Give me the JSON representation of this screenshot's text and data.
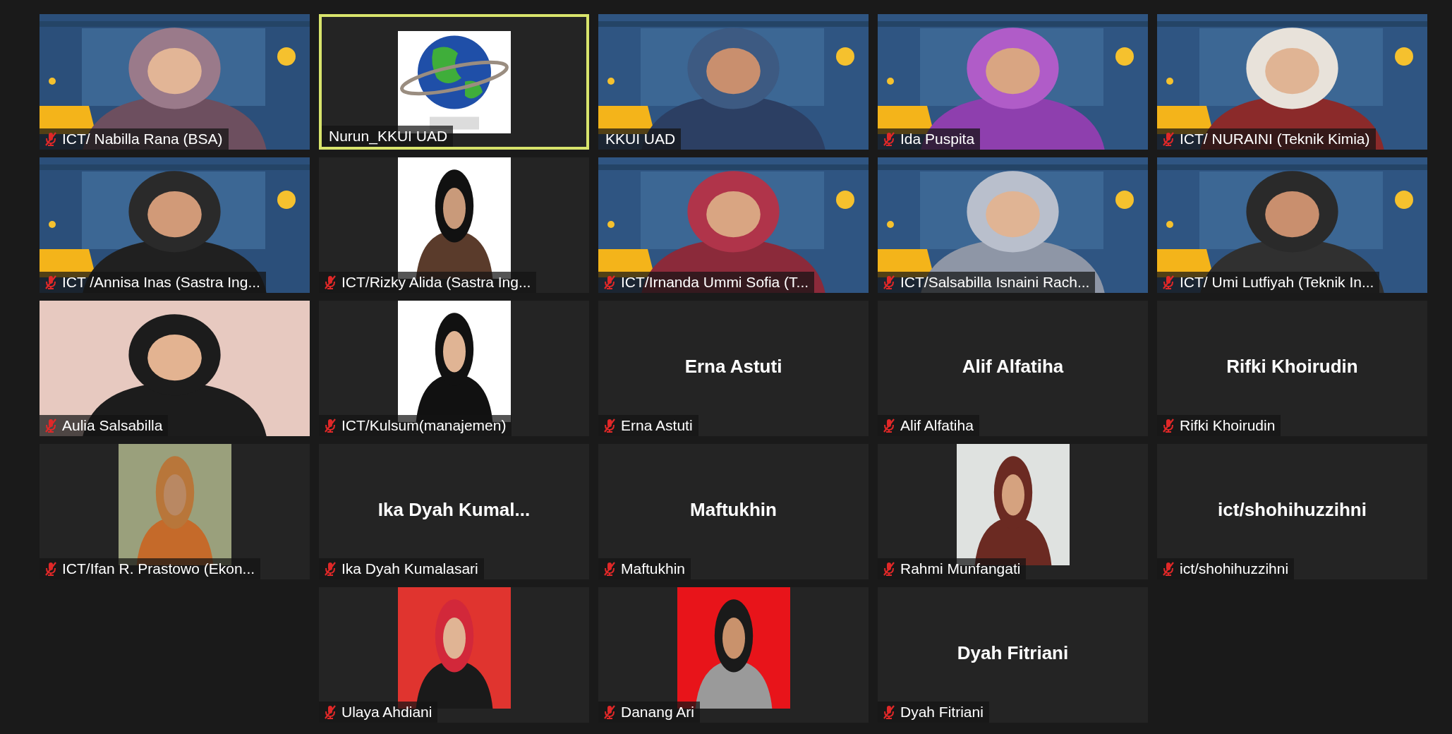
{
  "rows": [
    {
      "tiles": [
        {
          "kind": "video",
          "name": "ICT/ Nabilla Rana (BSA)",
          "muted": true,
          "speaking": false
        },
        {
          "name": "Nurun_KKUI UAD",
          "muted": false,
          "speaking": true
        },
        {
          "kind": "video",
          "name": "KKUI UAD",
          "muted": false,
          "speaking": false
        },
        {
          "kind": "video",
          "name": "Ida Puspita",
          "muted": true,
          "speaking": false
        },
        {
          "kind": "video",
          "name": "ICT/ NURAINI (Teknik Kimia)",
          "muted": true,
          "speaking": false
        }
      ]
    },
    {
      "tiles": [
        {
          "kind": "video",
          "name": "ICT /Annisa Inas (Sastra Ing...",
          "muted": true,
          "speaking": false
        },
        {
          "name": "ICT/Rizky Alida (Sastra Ing...",
          "muted": true,
          "speaking": false
        },
        {
          "kind": "video",
          "name": "ICT/Irnanda Ummi Sofia (T...",
          "muted": true,
          "speaking": false
        },
        {
          "kind": "video",
          "name": "ICT/Salsabilla Isnaini Rach...",
          "muted": true,
          "speaking": false
        },
        {
          "kind": "video",
          "name": "ICT/ Umi Lutfiyah (Teknik In...",
          "muted": true,
          "speaking": false
        }
      ]
    },
    {
      "tiles": [
        {
          "kind": "video",
          "name": "Aulia Salsabilla",
          "muted": true,
          "speaking": false
        },
        {
          "name": "ICT/Kulsum(manajemen)",
          "muted": true,
          "speaking": false
        },
        {
          "kind": "name",
          "display_name": "Erna Astuti",
          "name": "Erna Astuti",
          "muted": true,
          "speaking": false
        },
        {
          "kind": "name",
          "display_name": "Alif Alfatiha",
          "name": "Alif Alfatiha",
          "muted": true,
          "speaking": false
        },
        {
          "kind": "name",
          "display_name": "Rifki Khoirudin",
          "name": "Rifki Khoirudin",
          "muted": true,
          "speaking": false
        }
      ]
    },
    {
      "tiles": [
        {
          "name": "ICT/Ifan R. Prastowo (Ekon...",
          "muted": true,
          "speaking": false
        },
        {
          "kind": "name",
          "display_name": "Ika Dyah Kumal...",
          "name": "Ika Dyah Kumalasari",
          "muted": true,
          "speaking": false
        },
        {
          "kind": "name",
          "display_name": "Maftukhin",
          "name": "Maftukhin",
          "muted": true,
          "speaking": false
        },
        {
          "name": "Rahmi Munfangati",
          "muted": true,
          "speaking": false
        },
        {
          "kind": "name",
          "display_name": "ict/shohihuzzihni",
          "name": "ict/shohihuzzihni",
          "muted": true,
          "speaking": false
        }
      ]
    },
    {
      "tiles": [
        {
          "name": "Ulaya Ahdiani",
          "muted": true,
          "speaking": false
        },
        {
          "name": "Danang Ari",
          "muted": true,
          "speaking": false
        },
        {
          "kind": "name",
          "display_name": "Dyah Fitriani",
          "name": "Dyah Fitriani",
          "muted": true,
          "speaking": false
        }
      ]
    }
  ]
}
